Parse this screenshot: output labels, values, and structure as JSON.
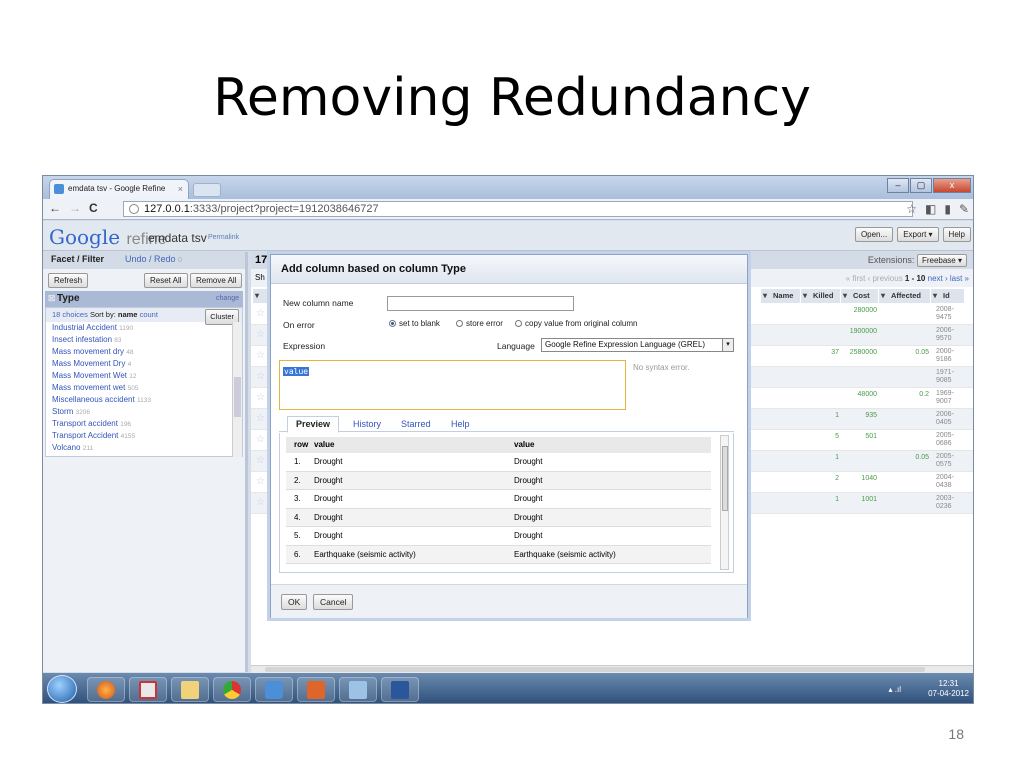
{
  "slide": {
    "title": "Removing Redundancy",
    "number": "18"
  },
  "browser": {
    "tab_title": "emdata tsv - Google Refine",
    "url_host": "127.0.0.1",
    "url_rest": ":3333/project?project=1912038646727",
    "nav_back": "←",
    "nav_forward": "→",
    "nav_reload": "C",
    "win_min": "–",
    "win_max": "▢",
    "win_close": "x"
  },
  "app": {
    "logo_google": "Google",
    "logo_refine": "refine",
    "project_name": "emdata tsv",
    "permalink": "Permalink",
    "open_label": "Open...",
    "export_label": "Export ▾",
    "help_label": "Help"
  },
  "left": {
    "tab_facet": "Facet / Filter",
    "tab_undo": "Undo / Redo",
    "undo_count": "0",
    "refresh": "Refresh",
    "reset_all": "Reset All",
    "remove_all": "Remove All",
    "facet_title": "Type",
    "facet_change": "change",
    "choices": "18 choices",
    "sort_by": "Sort by:",
    "sort_name": "name",
    "sort_count": "count",
    "cluster": "Cluster",
    "items": [
      {
        "name": "Industrial Accident",
        "count": "1190"
      },
      {
        "name": "Insect infestation",
        "count": "83"
      },
      {
        "name": "Mass movement dry",
        "count": "48"
      },
      {
        "name": "Mass Movement Dry",
        "count": "4"
      },
      {
        "name": "Mass Movement Wet",
        "count": "12"
      },
      {
        "name": "Mass movement wet",
        "count": "505"
      },
      {
        "name": "Miscellaneous accident",
        "count": "1133"
      },
      {
        "name": "Storm",
        "count": "3206"
      },
      {
        "name": "Transport accident",
        "count": "196"
      },
      {
        "name": "Transport Accident",
        "count": "4155"
      },
      {
        "name": "Volcano",
        "count": "211"
      }
    ]
  },
  "grid": {
    "rows_count": "17",
    "show_prefix": "Sh",
    "extensions": "Extensions:",
    "freebase": "Freebase ▾",
    "pager_first": "« first",
    "pager_prev": "‹ previous",
    "pager_range": "1 - 10",
    "pager_next": "next ›",
    "pager_last": "last »",
    "columns": [
      "Name",
      "Killed",
      "Cost",
      "Affected",
      "Id"
    ],
    "rows": [
      {
        "killed": "",
        "cost": "280000",
        "affected": "",
        "id1": "2008-",
        "id2": "9475"
      },
      {
        "killed": "",
        "cost": "1900000",
        "affected": "",
        "id1": "2006-",
        "id2": "9570"
      },
      {
        "killed": "37",
        "cost": "2580000",
        "affected": "0.05",
        "id1": "2000-",
        "id2": "9186"
      },
      {
        "killed": "",
        "cost": "",
        "affected": "",
        "id1": "1971-",
        "id2": "9085"
      },
      {
        "killed": "",
        "cost": "48000",
        "affected": "0.2",
        "id1": "1969-",
        "id2": "9007"
      },
      {
        "killed": "1",
        "cost": "935",
        "affected": "",
        "id1": "2006-",
        "id2": "0405"
      },
      {
        "killed": "5",
        "cost": "501",
        "affected": "",
        "id1": "2005-",
        "id2": "0686"
      },
      {
        "killed": "1",
        "cost": "",
        "affected": "0.05",
        "id1": "2005-",
        "id2": "0575"
      },
      {
        "killed": "2",
        "cost": "1040",
        "affected": "",
        "id1": "2004-",
        "id2": "0438"
      },
      {
        "killed": "1",
        "cost": "1001",
        "affected": "",
        "id1": "2003-",
        "id2": "0236"
      }
    ]
  },
  "dialog": {
    "title": "Add column based on column Type",
    "new_col_label": "New column name",
    "new_col_value": "",
    "on_error_label": "On error",
    "opt_blank": "set to blank",
    "opt_store": "store error",
    "opt_copy": "copy value from original column",
    "expression_label": "Expression",
    "language_label": "Language",
    "language_value": "Google Refine Expression Language (GREL)",
    "expression_value": "value",
    "syntax_status": "No syntax error.",
    "tabs": [
      "Preview",
      "History",
      "Starred",
      "Help"
    ],
    "table_headers": [
      "row",
      "value",
      "value"
    ],
    "table_rows": [
      {
        "row": "1.",
        "value": "Drought",
        "result": "Drought"
      },
      {
        "row": "2.",
        "value": "Drought",
        "result": "Drought"
      },
      {
        "row": "3.",
        "value": "Drought",
        "result": "Drought"
      },
      {
        "row": "4.",
        "value": "Drought",
        "result": "Drought"
      },
      {
        "row": "5.",
        "value": "Drought",
        "result": "Drought"
      },
      {
        "row": "6.",
        "value": "Earthquake (seismic activity)",
        "result": "Earthquake (seismic activity)"
      }
    ],
    "ok": "OK",
    "cancel": "Cancel"
  },
  "taskbar": {
    "time": "12:31",
    "date": "07-04-2012"
  }
}
